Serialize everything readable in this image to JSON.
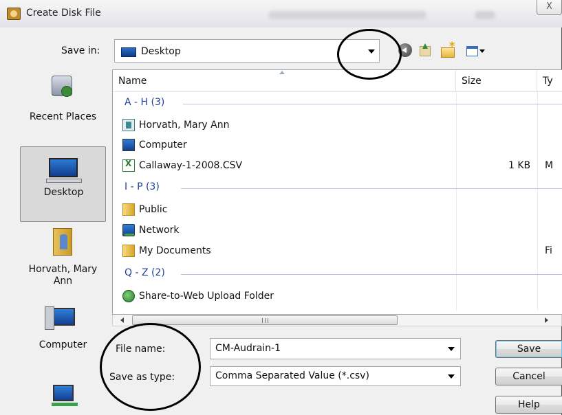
{
  "window": {
    "title": "Create Disk File",
    "close_glyph": "X"
  },
  "toolbar": {
    "save_in_label": "Save in:",
    "location": "Desktop",
    "icons": [
      "back-icon",
      "up-folder-icon",
      "new-folder-icon",
      "views-menu-icon"
    ]
  },
  "places": [
    {
      "label": "Recent Places",
      "icon": "recent-places-icon"
    },
    {
      "label": "Desktop",
      "icon": "desktop-icon",
      "selected": true
    },
    {
      "label": "Horvath, Mary Ann",
      "icon": "user-folder-icon"
    },
    {
      "label": "Computer",
      "icon": "computer-icon"
    },
    {
      "label": "",
      "icon": "network-icon"
    }
  ],
  "list": {
    "columns": {
      "name": "Name",
      "size": "Size",
      "type": "Ty"
    },
    "groups": [
      {
        "header": "A - H (3)",
        "items": [
          {
            "name": "Horvath, Mary Ann",
            "size": "",
            "type": "",
            "icon": "contact-folder-icon"
          },
          {
            "name": "Computer",
            "size": "",
            "type": "",
            "icon": "computer-icon"
          },
          {
            "name": "Callaway-1-2008.CSV",
            "size": "1 KB",
            "type": "M",
            "icon": "csv-file-icon"
          }
        ]
      },
      {
        "header": "I - P (3)",
        "items": [
          {
            "name": "Public",
            "size": "",
            "type": "",
            "icon": "folder-icon"
          },
          {
            "name": "Network",
            "size": "",
            "type": "",
            "icon": "network-icon"
          },
          {
            "name": "My Documents",
            "size": "",
            "type": "Fi",
            "icon": "folder-icon"
          }
        ]
      },
      {
        "header": "Q - Z (2)",
        "items": [
          {
            "name": "Share-to-Web Upload Folder",
            "size": "",
            "type": "",
            "icon": "share-folder-icon"
          }
        ]
      }
    ],
    "hscroll_grip": "III"
  },
  "form": {
    "file_name_label": "File name:",
    "file_name_value": "CM-Audrain-1",
    "save_as_type_label": "Save as type:",
    "save_as_type_value": "Comma Separated Value (*.csv)"
  },
  "buttons": {
    "save": "Save",
    "cancel": "Cancel",
    "help": "Help"
  },
  "colors": {
    "group_header": "#1e3f9a",
    "annotation": "#000000"
  }
}
